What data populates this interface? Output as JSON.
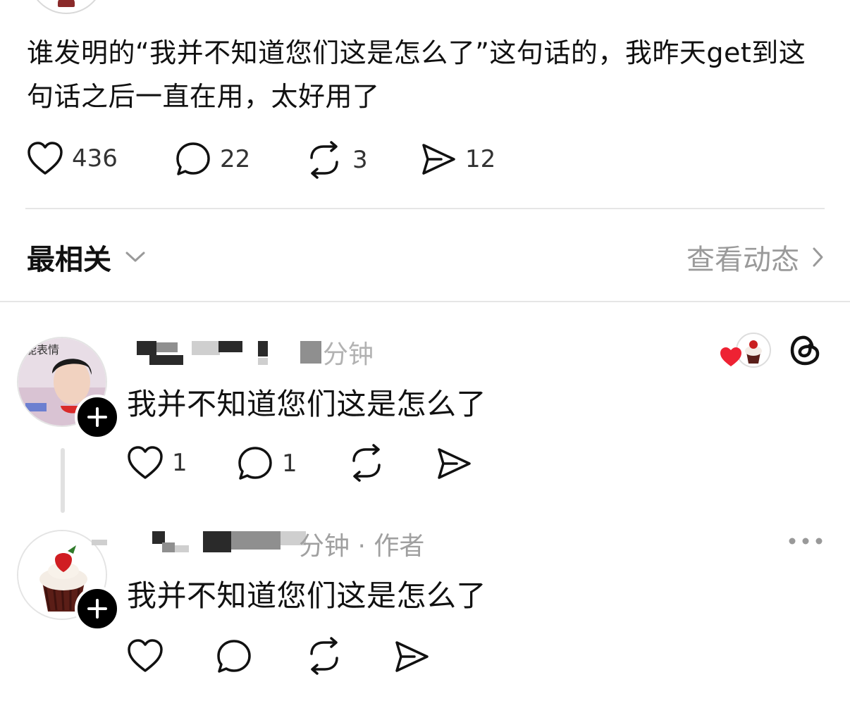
{
  "post": {
    "text": "谁发明的“我并不知道您们这是怎么了”这句话的，我昨天get到这句话之后一直在用，太好用了",
    "likes": "436",
    "comments": "22",
    "reposts": "3",
    "shares": "12"
  },
  "sort": {
    "label": "最相关",
    "activity_link": "查看动态"
  },
  "replies": [
    {
      "time_fragment": "分钟",
      "text": "我并不知道您们这是怎么了",
      "likes": "1",
      "comments": "1",
      "avatar_text": "能表情"
    },
    {
      "time_fragment": "分钟 · 作者",
      "text": "我并不知道您们这是怎么了"
    }
  ],
  "colors": {
    "heart_red": "#ee2233",
    "muted": "#9a9a9a"
  },
  "icons": [
    "heart-icon",
    "comment-icon",
    "repost-icon",
    "share-icon",
    "chevron-down-icon",
    "chevron-right-icon",
    "plus-icon",
    "threads-logo-icon",
    "more-icon"
  ]
}
